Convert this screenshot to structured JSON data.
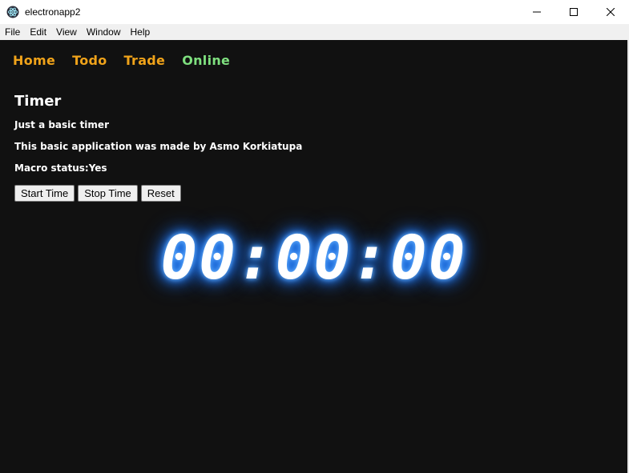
{
  "window": {
    "title": "electronapp2"
  },
  "menu": {
    "items": [
      "File",
      "Edit",
      "View",
      "Window",
      "Help"
    ]
  },
  "nav": {
    "items": [
      {
        "label": "Home",
        "active": false
      },
      {
        "label": "Todo",
        "active": false
      },
      {
        "label": "Trade",
        "active": false
      },
      {
        "label": "Online",
        "active": true
      }
    ]
  },
  "page": {
    "title": "Timer",
    "subtitle": "Just a basic timer",
    "credit": "This basic application was made by Asmo Korkiatupa",
    "macro_status": "Macro status:Yes"
  },
  "buttons": {
    "start": "Start Time",
    "stop": "Stop Time",
    "reset": "Reset"
  },
  "timer": {
    "display": "00:00:00"
  },
  "colors": {
    "nav_link": "#f0a31a",
    "nav_active": "#7fe07f",
    "background": "#111111",
    "timer_glow": "#2f8dff"
  }
}
